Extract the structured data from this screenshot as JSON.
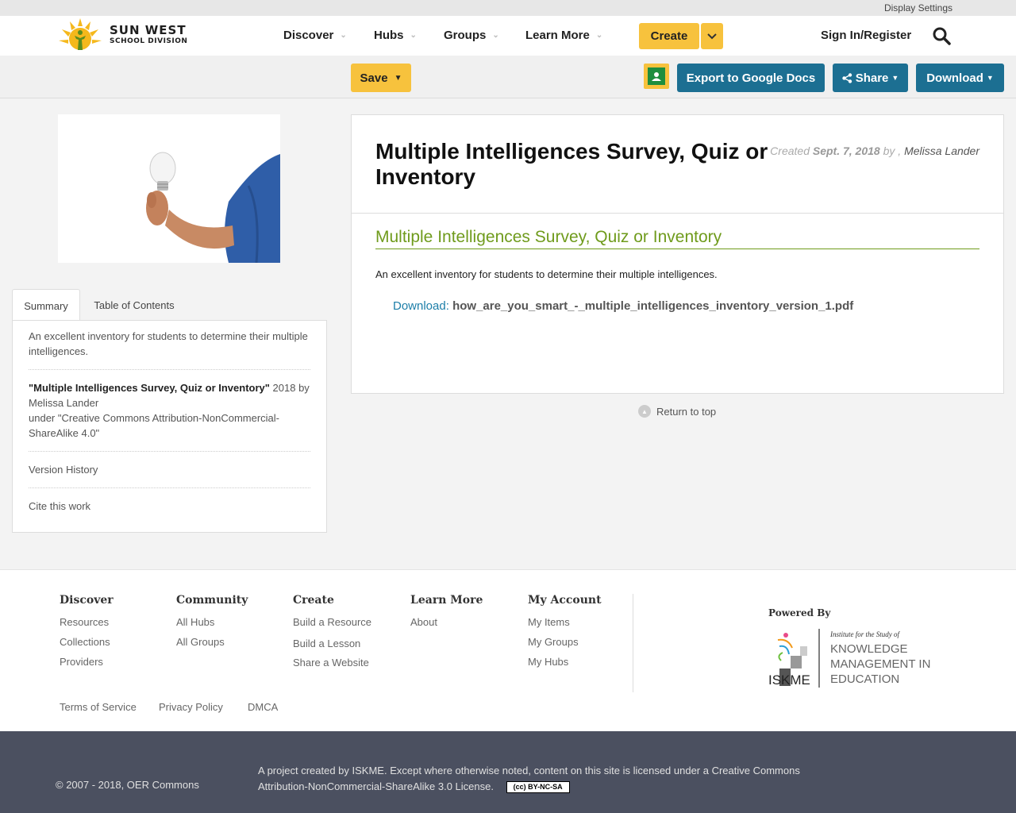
{
  "utility": {
    "display_settings": "Display Settings"
  },
  "header": {
    "logo_line1": "SUN WEST",
    "logo_line2": "SCHOOL DIVISION",
    "nav": [
      "Discover",
      "Hubs",
      "Groups",
      "Learn More"
    ],
    "create_label": "Create",
    "signin_label": "Sign In/Register"
  },
  "actionbar": {
    "save_label": "Save",
    "export_label": "Export to Google Docs",
    "share_label": "Share",
    "download_label": "Download"
  },
  "tabs": {
    "summary": "Summary",
    "toc": "Table of Contents"
  },
  "summary": {
    "description": "An excellent inventory for students to determine their multiple intelligences.",
    "citation_title": "\"Multiple Intelligences Survey, Quiz or Inventory\"",
    "citation_rest": " 2018 by Melissa Lander",
    "license_line": "under \"Creative Commons Attribution-NonCommercial-ShareAlike 4.0\"",
    "version_history": "Version History",
    "cite": "Cite this work"
  },
  "resource": {
    "title": "Multiple Intelligences Survey, Quiz or Inventory",
    "created_prefix": "Created ",
    "created_date": "Sept. 7, 2018",
    "by": " by , ",
    "author": "Melissa Lander",
    "link_title": "Multiple Intelligences Survey, Quiz or Inventory",
    "description": "An excellent inventory for students to determine their multiple intelligences.",
    "download_label": "Download:",
    "download_file": "how_are_you_smart_-_multiple_intelligences_inventory_version_1.pdf"
  },
  "return_top": "Return to top",
  "footer": {
    "cols": [
      {
        "heading": "Discover",
        "links": [
          "Resources",
          "Collections",
          "Providers"
        ]
      },
      {
        "heading": "Community",
        "links": [
          "All Hubs",
          "All Groups"
        ]
      },
      {
        "heading": "Create",
        "links": [
          "Build a Resource",
          "Build a Lesson",
          "Share a Website"
        ]
      },
      {
        "heading": "Learn More",
        "links": [
          "About"
        ]
      },
      {
        "heading": "My Account",
        "links": [
          "My Items",
          "My Groups",
          "My Hubs"
        ]
      }
    ],
    "powered_by": "Powered By",
    "iskme_line1": "Institute for the Study of",
    "iskme_line2": "KNOWLEDGE",
    "iskme_line3": "MANAGEMENT IN",
    "iskme_line4": "EDUCATION",
    "iskme_abbr": "ISKME",
    "bottom_links": [
      "Terms of Service",
      "Privacy Policy",
      "DMCA"
    ],
    "copyright": "© 2007 - 2018, OER Commons",
    "project_text": "A project created by ISKME. Except where otherwise noted, content on this site is licensed under a Creative Commons Attribution-NonCommercial-ShareAlike 3.0 License.",
    "cc_badge": "BY-NC-SA"
  },
  "colors": {
    "accent_yellow": "#f7c23d",
    "teal": "#1c6f92",
    "link_green": "#6f9b1c",
    "footer_dark": "#4b5060"
  }
}
